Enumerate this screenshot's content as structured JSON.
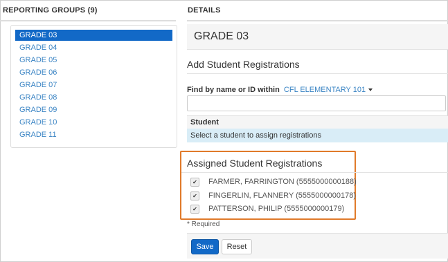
{
  "left": {
    "heading": "REPORTING GROUPS (9)",
    "groups": [
      "GRADE 03",
      "GRADE 04",
      "GRADE 05",
      "GRADE 06",
      "GRADE 07",
      "GRADE 08",
      "GRADE 09",
      "GRADE 10",
      "GRADE 11"
    ],
    "selected": "GRADE 03"
  },
  "details": {
    "heading": "DETAILS",
    "title": "GRADE 03",
    "add_title": "Add Student Registrations",
    "find_label": "Find by name or ID within",
    "find_scope": "CFL ELEMENTARY 101",
    "search_value": "",
    "student_column": "Student",
    "student_placeholder_row": "Select a student to assign registrations",
    "assigned_title": "Assigned Student Registrations",
    "assigned": [
      {
        "label": "FARMER, FARRINGTON (5555000000188)",
        "checked": true
      },
      {
        "label": "FINGERLIN, FLANNERY (5555000000178)",
        "checked": true
      },
      {
        "label": "PATTERSON, PHILIP (5555000000179)",
        "checked": true
      }
    ],
    "required_note": "* Required",
    "save_label": "Save",
    "reset_label": "Reset"
  },
  "colors": {
    "primary": "#1269c7",
    "link": "#3a84c4",
    "highlight_box": "#e07a2a",
    "row_info": "#d9edf7"
  },
  "icons": {
    "dropdown": "caret-down-icon",
    "checkbox": "check-icon"
  }
}
